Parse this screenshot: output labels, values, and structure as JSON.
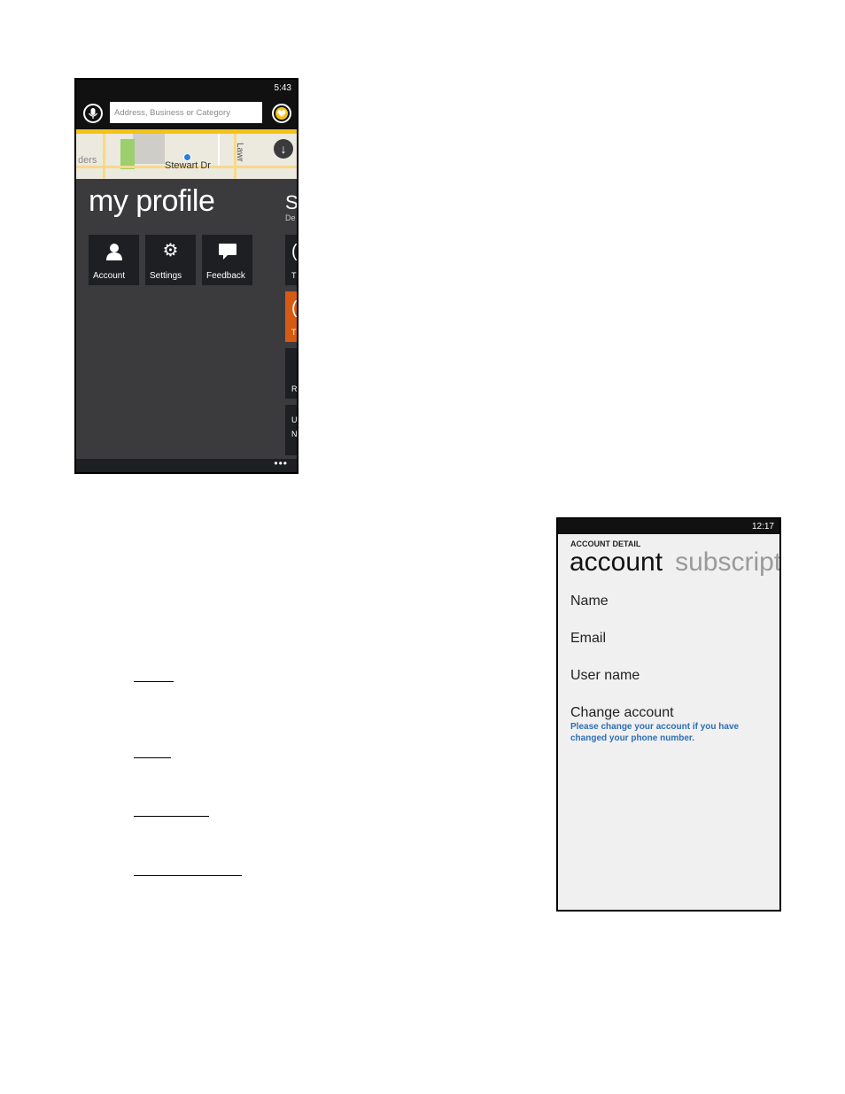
{
  "phone_profile": {
    "status_time": "5:43",
    "search_placeholder": "Address, Business or Category",
    "map": {
      "street_label": "Stewart Dr",
      "left_label": "ders",
      "right_label": "Lawr"
    },
    "title": "my profile",
    "tiles": [
      {
        "label": "Account",
        "icon": "person-icon"
      },
      {
        "label": "Settings",
        "icon": "gear-icon"
      },
      {
        "label": "Feedback",
        "icon": "speech-bubble-icon"
      }
    ],
    "peek": {
      "title": "S",
      "subtitle": "De",
      "tiles": [
        {
          "big": "(",
          "small": "T"
        },
        {
          "big": "(",
          "small": "T"
        },
        {
          "big": "",
          "small": "R"
        },
        {
          "big": "",
          "small": "U"
        }
      ],
      "last_tile_second_line": "N"
    },
    "appbar_more": "•••",
    "colors": {
      "accent_yellow": "#f4c315",
      "background": "#3b3b3d",
      "tile": "#1d1f22",
      "orange": "#d65a12"
    }
  },
  "phone_account": {
    "status_time": "12:17",
    "header": "ACCOUNT DETAIL",
    "pivot_active": "account",
    "pivot_inactive": "subscript",
    "items": [
      "Name",
      "Email",
      "User name",
      "Change account"
    ],
    "change_account_note": "Please change your account if you have changed your phone number.",
    "colors": {
      "note_blue": "#2d6eb5",
      "background": "#f0f0f0"
    }
  }
}
